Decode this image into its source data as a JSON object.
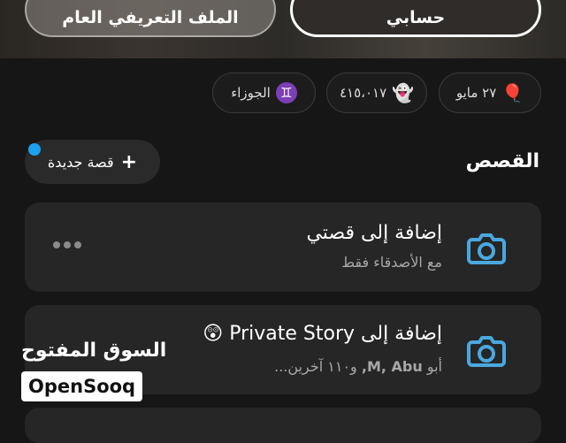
{
  "header": {
    "account_button": "حسابي",
    "profile_button": "الملف التعريفي العام"
  },
  "chips": [
    {
      "icon": "balloon-icon",
      "label": "٢٧ مايو"
    },
    {
      "icon": "ghost-icon",
      "label": "٤١٥،٠١٧"
    },
    {
      "icon": "gemini-icon",
      "glyph": "♊",
      "label": "الجوزاء"
    }
  ],
  "stories": {
    "section_title": "القصص",
    "new_story_label": "قصة جديدة",
    "items": [
      {
        "title": "إضافة إلى قصتي",
        "subtitle": "مع الأصدقاء فقط"
      },
      {
        "title": "إضافة إلى Private Story 😲",
        "subtitle_prefix": "أبو",
        "subtitle_names": "M, Abu,",
        "subtitle_suffix": "و١١٠ آخرين..."
      }
    ]
  },
  "watermark": {
    "arabic": "السوق المفتوح",
    "english": "OpenSooq"
  },
  "colors": {
    "accent": "#1ea0f0",
    "camera": "#4aa8e0",
    "background": "#161616"
  }
}
